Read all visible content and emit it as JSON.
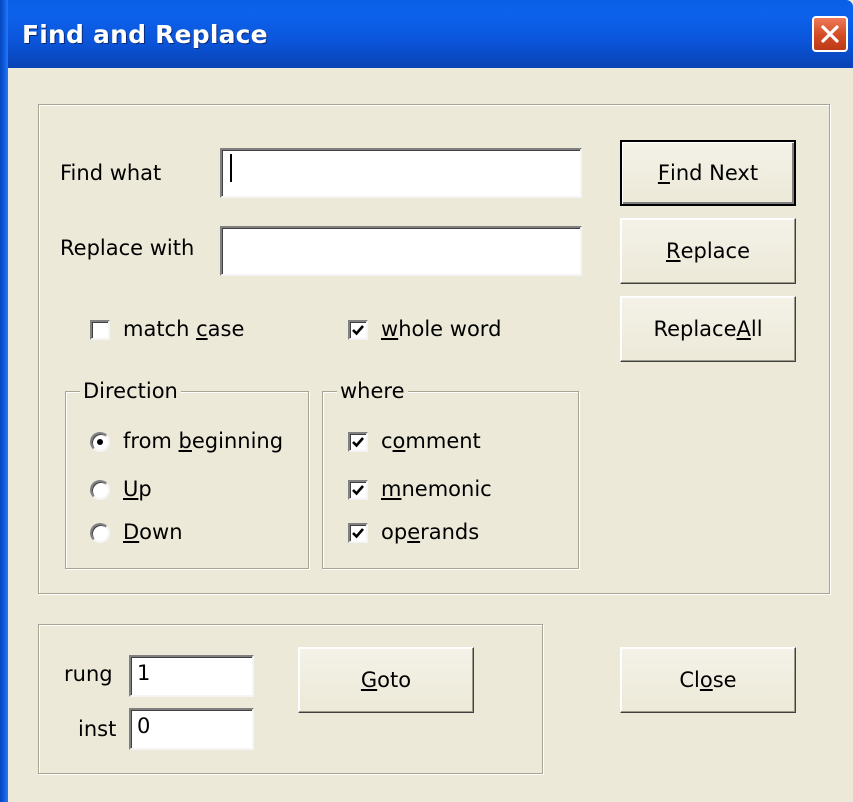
{
  "window": {
    "title": "Find and Replace"
  },
  "find": {
    "find_label": "Find what",
    "find_value": "",
    "replace_label": "Replace with",
    "replace_value": ""
  },
  "buttons": {
    "find_next": {
      "pre": "",
      "key": "F",
      "post": "ind Next"
    },
    "replace": {
      "pre": "",
      "key": "R",
      "post": "eplace"
    },
    "replace_all": {
      "pre": "Replace ",
      "key": "A",
      "post": "ll"
    },
    "goto": {
      "pre": "",
      "key": "G",
      "post": "oto"
    },
    "close": {
      "pre": "Cl",
      "key": "o",
      "post": "se"
    }
  },
  "options": {
    "match_case": {
      "pre": "match ",
      "key": "c",
      "post": "ase",
      "checked": false
    },
    "whole_word": {
      "pre": "",
      "key": "w",
      "post": "hole word",
      "checked": true
    }
  },
  "direction": {
    "title": "Direction",
    "options": [
      {
        "pre": "from ",
        "key": "b",
        "post": "eginning",
        "selected": true
      },
      {
        "pre": "",
        "key": "U",
        "post": "p",
        "selected": false
      },
      {
        "pre": "",
        "key": "D",
        "post": "own",
        "selected": false
      }
    ]
  },
  "where": {
    "title": "where",
    "options": [
      {
        "pre": "c",
        "key": "o",
        "post": "mment",
        "checked": true
      },
      {
        "pre": "",
        "key": "m",
        "post": "nemonic",
        "checked": true
      },
      {
        "pre": "op",
        "key": "e",
        "post": "rands",
        "checked": true
      }
    ]
  },
  "goto": {
    "rung_label": "rung",
    "rung_value": "1",
    "inst_label": "inst",
    "inst_value": "0"
  }
}
